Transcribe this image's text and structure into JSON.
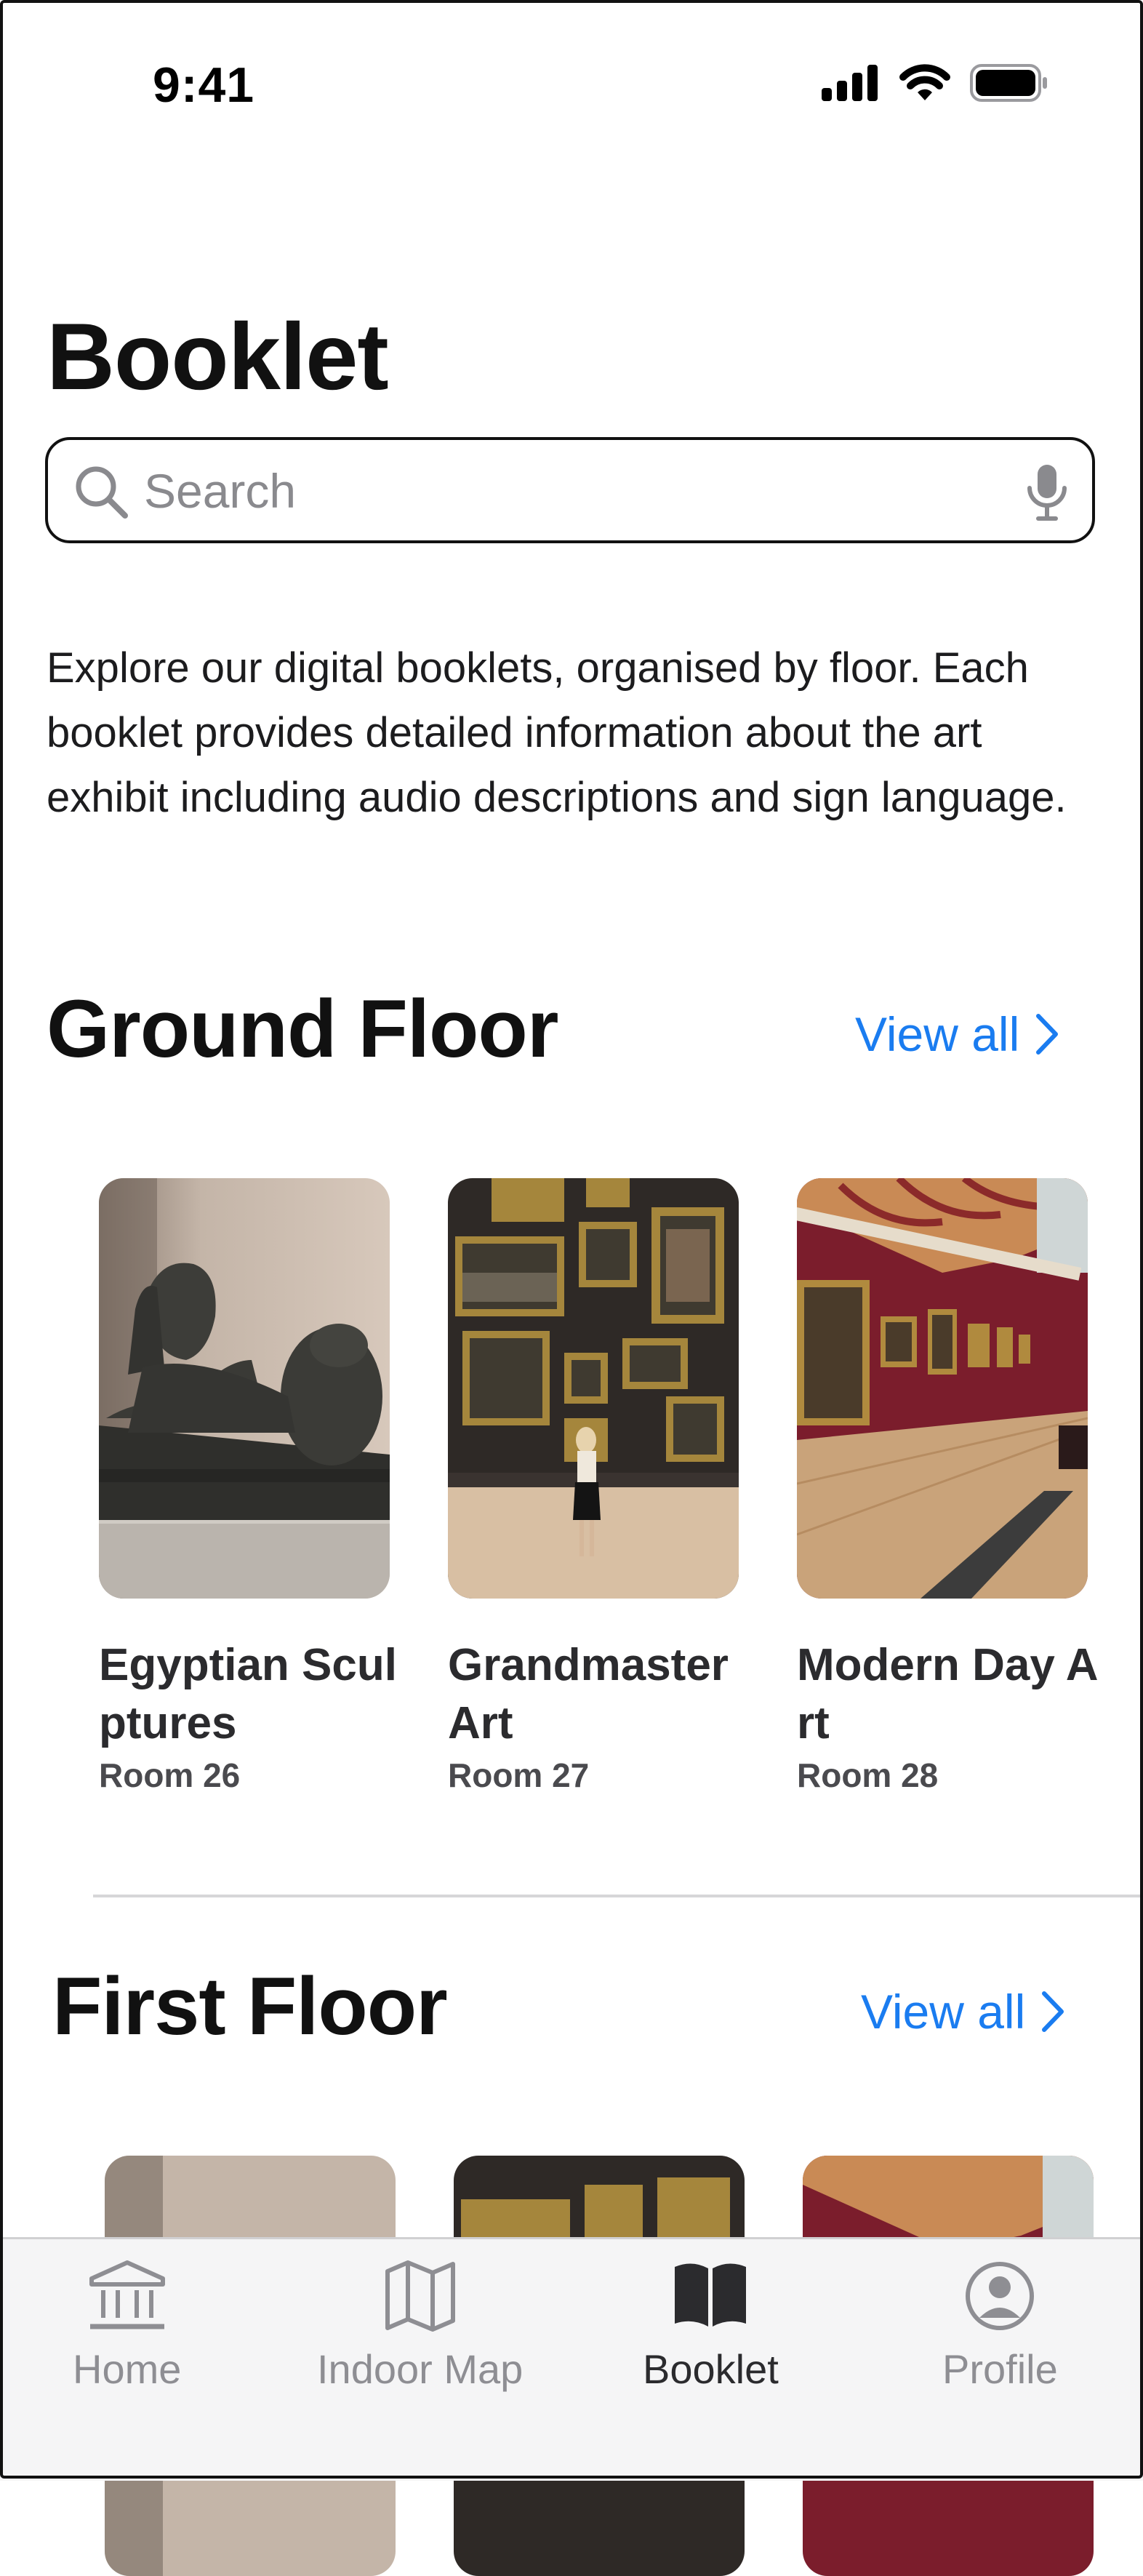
{
  "status": {
    "time": "9:41"
  },
  "page": {
    "title": "Booklet",
    "search_placeholder": "Search",
    "intro": "Explore our digital booklets, organised by floor. Each booklet provides detailed information about the art exhibit including audio descriptions and sign language."
  },
  "sections": [
    {
      "title": "Ground Floor",
      "view_all": "View all",
      "cards": [
        {
          "title": "Egyptian Sculptures",
          "room": "Room 26"
        },
        {
          "title": "Grandmaster Art",
          "room": "Room 27"
        },
        {
          "title": "Modern Day Art",
          "room": "Room 28"
        }
      ]
    },
    {
      "title": "First Floor",
      "view_all": "View all"
    }
  ],
  "tabs": [
    {
      "label": "Home",
      "icon": "museum-icon"
    },
    {
      "label": "Indoor Map",
      "icon": "map-icon"
    },
    {
      "label": "Booklet",
      "icon": "book-icon"
    },
    {
      "label": "Profile",
      "icon": "profile-icon"
    }
  ],
  "colors": {
    "accent": "#1a7cf0",
    "tab_active": "#2b2b2e",
    "tab_inactive": "#8e8e93"
  }
}
